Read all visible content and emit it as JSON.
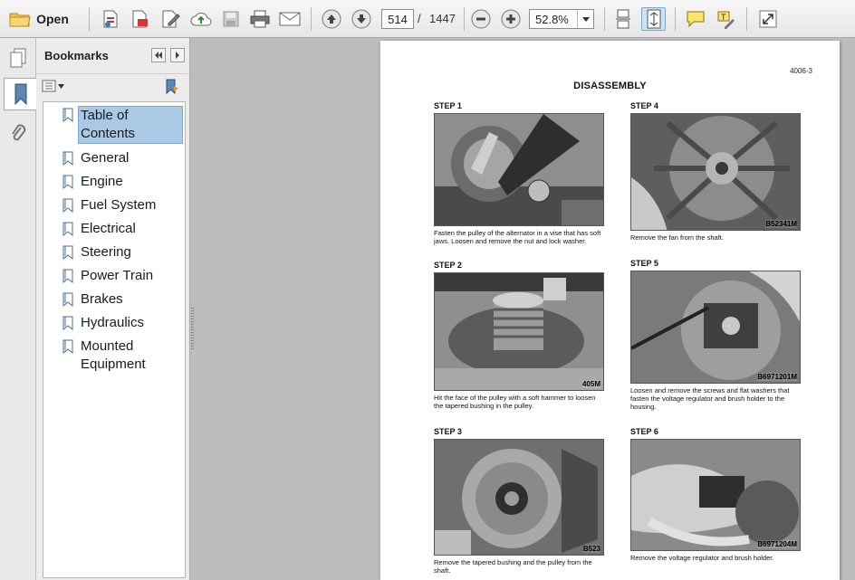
{
  "toolbar": {
    "open_label": "Open",
    "current_page": "514",
    "page_separator": "/",
    "total_pages": "1447",
    "zoom": "52.8%"
  },
  "bookmarks": {
    "title": "Bookmarks",
    "items": [
      {
        "label": "Table of Contents",
        "selected": true
      },
      {
        "label": "General"
      },
      {
        "label": "Engine"
      },
      {
        "label": "Fuel System"
      },
      {
        "label": "Electrical"
      },
      {
        "label": "Steering"
      },
      {
        "label": "Power Train"
      },
      {
        "label": "Brakes"
      },
      {
        "label": "Hydraulics"
      },
      {
        "label": "Mounted Equipment"
      }
    ]
  },
  "document": {
    "page_number": "4006-3",
    "heading": "DISASSEMBLY",
    "steps": [
      {
        "title": "STEP 1",
        "code": "",
        "caption": "Fasten the pulley of the alternator in a vise that has soft jaws. Loosen and remove the nut and lock washer."
      },
      {
        "title": "STEP 2",
        "code": "405M",
        "caption": "Hit the face of the pulley with a soft hammer to loosen the tapered bushing in the pulley."
      },
      {
        "title": "STEP 3",
        "code": "B523",
        "caption": "Remove the tapered bushing and the pulley from the shaft."
      },
      {
        "title": "STEP 4",
        "code": "B52341M",
        "caption": "Remove the fan from the shaft."
      },
      {
        "title": "STEP 5",
        "code": "B6971201M",
        "caption": "Loosen and remove the screws and flat washers that fasten the voltage regulator and brush holder to the housing."
      },
      {
        "title": "STEP 6",
        "code": "B6971204M",
        "caption": "Remove the voltage regulator and brush holder."
      }
    ]
  },
  "colors": {
    "selection": "#a9c9e4",
    "toolbar_bg": "#ececec",
    "doc_bg": "#bcbcbc"
  }
}
